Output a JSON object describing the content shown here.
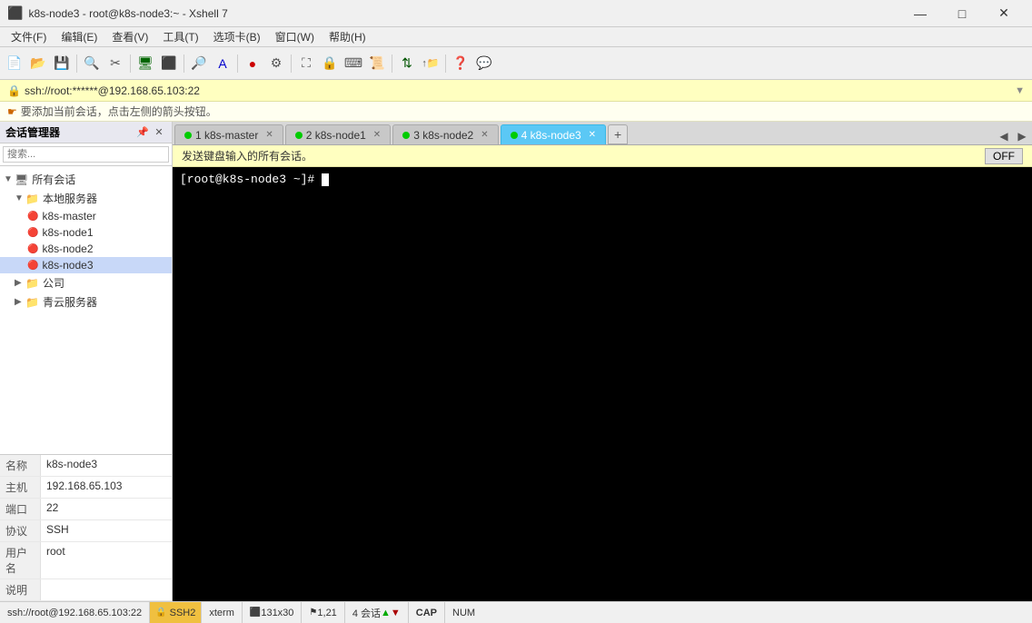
{
  "titlebar": {
    "title": "k8s-node3 - root@k8s-node3:~ - Xshell 7",
    "icon": "terminal-icon",
    "min_btn": "—",
    "max_btn": "□",
    "close_btn": "✕"
  },
  "menubar": {
    "items": [
      {
        "label": "文件(F)"
      },
      {
        "label": "编辑(E)"
      },
      {
        "label": "查看(V)"
      },
      {
        "label": "工具(T)"
      },
      {
        "label": "选项卡(B)"
      },
      {
        "label": "窗口(W)"
      },
      {
        "label": "帮助(H)"
      }
    ]
  },
  "ssh_bar": {
    "text": "ssh://root:******@192.168.65.103:22"
  },
  "hint_bar": {
    "text": "要添加当前会话，点击左侧的箭头按钮。"
  },
  "sidebar": {
    "header": "会话管理器",
    "tree": [
      {
        "id": "all-sessions",
        "label": "所有会话",
        "level": 0,
        "type": "root",
        "expanded": true
      },
      {
        "id": "local-servers",
        "label": "本地服务器",
        "level": 1,
        "type": "folder",
        "expanded": true
      },
      {
        "id": "k8s-master",
        "label": "k8s-master",
        "level": 2,
        "type": "server"
      },
      {
        "id": "k8s-node1",
        "label": "k8s-node1",
        "level": 2,
        "type": "server"
      },
      {
        "id": "k8s-node2",
        "label": "k8s-node2",
        "level": 2,
        "type": "server"
      },
      {
        "id": "k8s-node3",
        "label": "k8s-node3",
        "level": 2,
        "type": "server",
        "selected": true
      },
      {
        "id": "company",
        "label": "公司",
        "level": 1,
        "type": "folder",
        "expanded": false
      },
      {
        "id": "qingyun",
        "label": "青云服务器",
        "level": 1,
        "type": "folder",
        "expanded": false
      }
    ]
  },
  "properties": {
    "rows": [
      {
        "label": "名称",
        "value": "k8s-node3"
      },
      {
        "label": "主机",
        "value": "192.168.65.103"
      },
      {
        "label": "端口",
        "value": "22"
      },
      {
        "label": "协议",
        "value": "SSH"
      },
      {
        "label": "用户名",
        "value": "root"
      },
      {
        "label": "说明",
        "value": ""
      }
    ]
  },
  "tabs": [
    {
      "id": "tab1",
      "number": "1",
      "label": "k8s-master",
      "active": false,
      "dot_color": "#00cc00"
    },
    {
      "id": "tab2",
      "number": "2",
      "label": "k8s-node1",
      "active": false,
      "dot_color": "#00cc00"
    },
    {
      "id": "tab3",
      "number": "3",
      "label": "k8s-node2",
      "active": false,
      "dot_color": "#00cc00"
    },
    {
      "id": "tab4",
      "number": "4",
      "label": "k8s-node3",
      "active": true,
      "dot_color": "#00cc00"
    }
  ],
  "broadcast_bar": {
    "text": "发送键盘输入的所有会话。",
    "off_btn": "OFF"
  },
  "terminal": {
    "prompt": "[root@k8s-node3 ~]# "
  },
  "statusbar": {
    "path": "ssh://root@192.168.65.103:22",
    "protocol": "SSH2",
    "terminal": "xterm",
    "size": "131x30",
    "position": "1,21",
    "sessions": "4 会话",
    "cap": "CAP",
    "num": "NUM"
  }
}
